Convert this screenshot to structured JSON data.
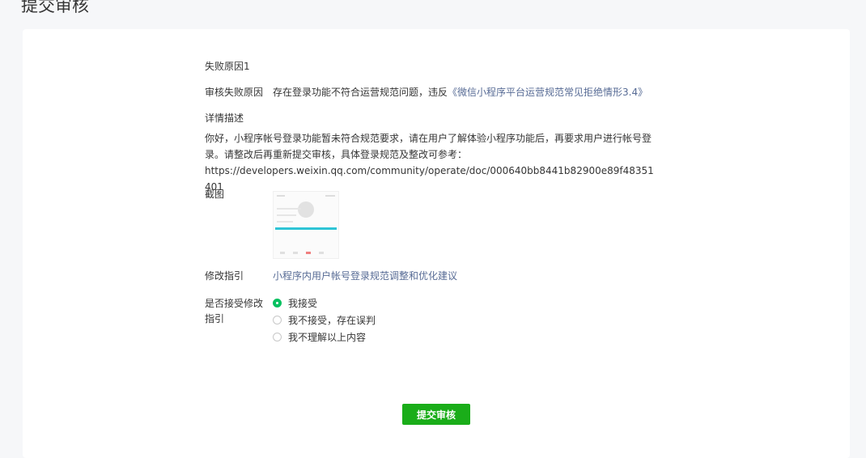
{
  "page": {
    "title": "提交审核"
  },
  "failure": {
    "section_title": "失败原因1",
    "reason_label": "审核失败原因",
    "reason_text": "存在登录功能不符合运营规范问题，违反",
    "reason_link": "《微信小程序平台运营规范常见拒绝情形3.4》",
    "desc_label": "详情描述",
    "desc_text": "你好，小程序帐号登录功能暂未符合规范要求，请在用户了解体验小程序功能后，再要求用户进行帐号登录。请整改后再重新提交审核，具体登录规范及整改可参考：",
    "desc_url": "https://developers.weixin.qq.com/community/operate/doc/000640bb8441b82900e89f48351401",
    "screenshot_label": "截图",
    "guide_label": "修改指引",
    "guide_link": "小程序内用户帐号登录规范调整和优化建议",
    "accept_label": "是否接受修改指引",
    "options": [
      {
        "label": "我接受",
        "checked": true
      },
      {
        "label": "我不接受，存在误判",
        "checked": false
      },
      {
        "label": "我不理解以上内容",
        "checked": false
      }
    ]
  },
  "actions": {
    "submit_label": "提交审核"
  },
  "colors": {
    "primary": "#1aad19",
    "link": "#576b95",
    "radio_checked": "#07c160"
  }
}
